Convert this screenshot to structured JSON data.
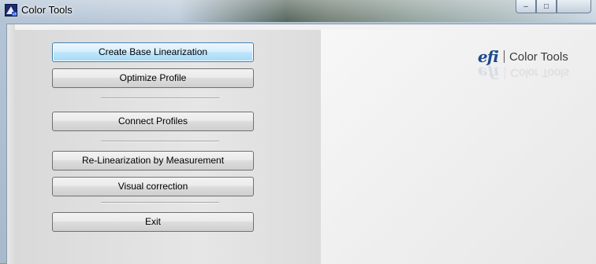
{
  "window": {
    "title": "Color Tools",
    "controls": {
      "minimize": "–",
      "maximize": "□",
      "close": ""
    }
  },
  "buttons": [
    {
      "label": "Create Base Linearization",
      "focused": true
    },
    {
      "label": "Optimize Profile"
    },
    {
      "label": "Connect Profiles"
    },
    {
      "label": "Re-Linearization by Measurement"
    },
    {
      "label": "Visual correction"
    },
    {
      "label": "Exit"
    }
  ],
  "logo": {
    "brand": "efi",
    "product": "Color Tools"
  },
  "colors": {
    "brand_blue": "#1e4a8c",
    "focus_border": "#3c7fb1"
  }
}
